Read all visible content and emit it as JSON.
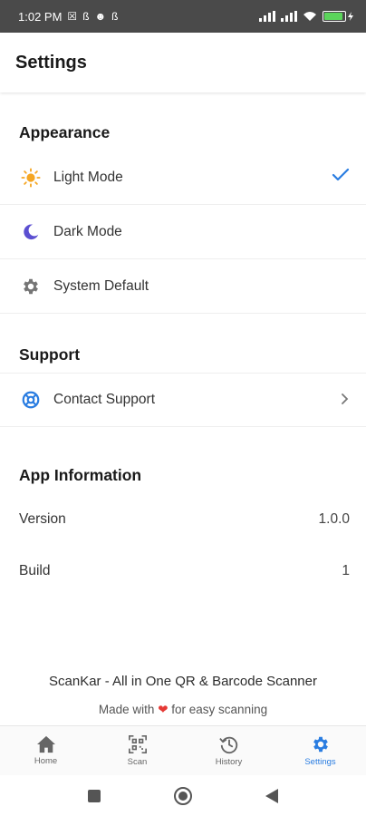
{
  "status_bar": {
    "time": "1:02 PM",
    "left_glyphs": [
      "☒",
      "ß",
      "☻",
      "ß"
    ],
    "battery_color": "#5bd45b"
  },
  "app_bar": {
    "title": "Settings"
  },
  "appearance": {
    "title": "Appearance",
    "options": [
      {
        "label": "Light Mode",
        "icon": "sun-icon",
        "selected": true
      },
      {
        "label": "Dark Mode",
        "icon": "moon-icon",
        "selected": false
      },
      {
        "label": "System Default",
        "icon": "gear-icon",
        "selected": false
      }
    ]
  },
  "support": {
    "title": "Support",
    "items": [
      {
        "label": "Contact Support",
        "icon": "lifebuoy-icon"
      }
    ]
  },
  "app_info": {
    "title": "App Information",
    "rows": [
      {
        "label": "Version",
        "value": "1.0.0"
      },
      {
        "label": "Build",
        "value": "1"
      }
    ]
  },
  "footer": {
    "app_name": "ScanKar - All in One QR & Barcode Scanner",
    "made_prefix": "Made with",
    "made_suffix": "for easy scanning"
  },
  "bottom_nav": {
    "items": [
      {
        "label": "Home",
        "icon": "home-icon"
      },
      {
        "label": "Scan",
        "icon": "qr-scan-icon"
      },
      {
        "label": "History",
        "icon": "history-icon"
      },
      {
        "label": "Settings",
        "icon": "settings-gear-icon",
        "active": true
      }
    ]
  },
  "colors": {
    "accent": "#2a7de1",
    "sun": "#f5a623",
    "moon": "#5b4fd1",
    "heart": "#e53935"
  }
}
